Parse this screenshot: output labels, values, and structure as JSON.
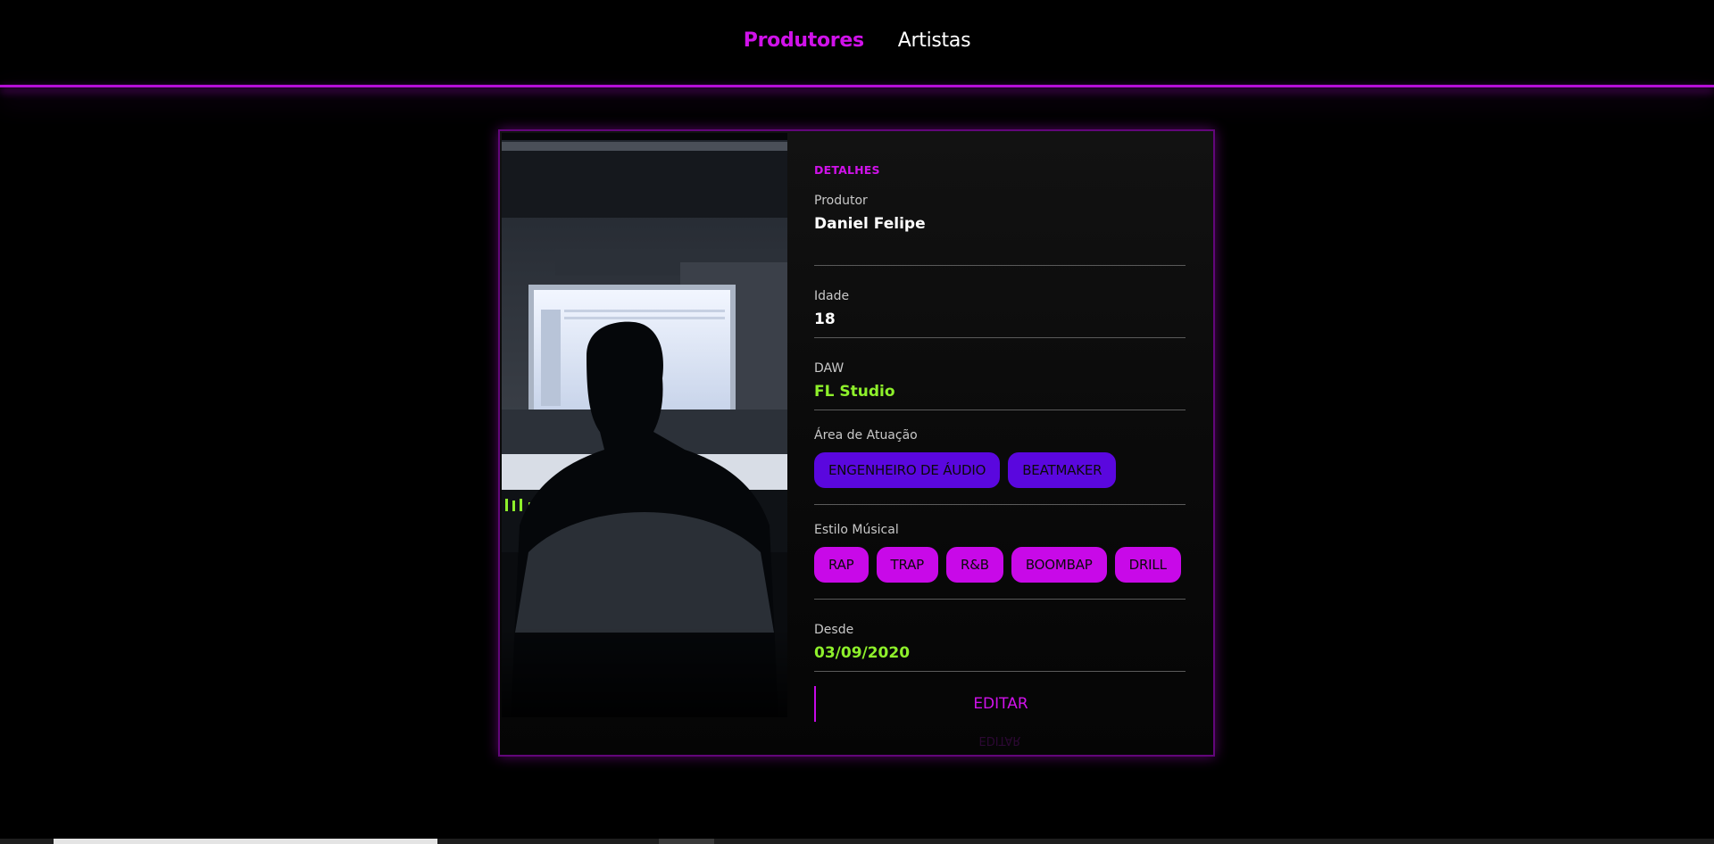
{
  "nav": {
    "items": [
      {
        "label": "Produtores",
        "active": true
      },
      {
        "label": "Artistas",
        "active": false
      }
    ]
  },
  "details": {
    "section_title": "DETALHES",
    "produtor_label": "Produtor",
    "produtor_value": "Daniel Felipe",
    "idade_label": "Idade",
    "idade_value": "18",
    "daw_label": "DAW",
    "daw_value": "FL Studio",
    "area_label": "Área de Atuação",
    "area_chips": [
      "ENGENHEIRO DE ÁUDIO",
      "BEATMAKER"
    ],
    "estilo_label": "Estilo Músical",
    "estilo_chips": [
      "RAP",
      "TRAP",
      "R&B",
      "BOOMBAP",
      "DRILL"
    ],
    "desde_label": "Desde",
    "desde_value": "03/09/2020",
    "edit_label": "EDITAR"
  },
  "colors": {
    "accent": "#d012ea",
    "chip_purple": "#5a07de",
    "chip_magenta": "#c809e8",
    "green": "#8ef02b"
  },
  "photo": {
    "icon": "producer-photo"
  }
}
